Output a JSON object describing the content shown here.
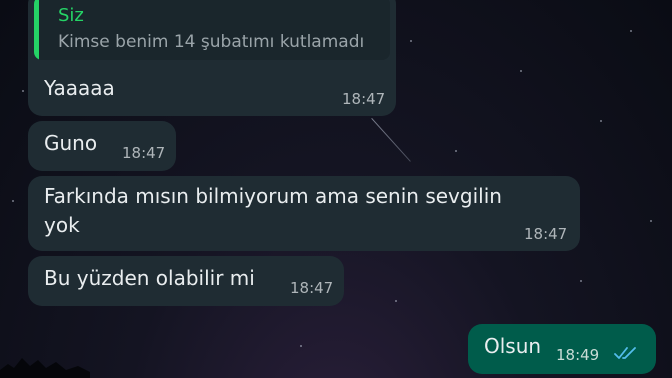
{
  "reply_quote": {
    "author": "Siz",
    "text": "Kimse benim 14 şubatımı kutlamadı"
  },
  "messages": [
    {
      "text": "Yaaaaa",
      "time": "18:47",
      "direction": "in"
    },
    {
      "text": "Guno",
      "time": "18:47",
      "direction": "in"
    },
    {
      "text_line1": "Farkında mısın bilmiyorum ama senin sevgilin",
      "text_line2": "yok",
      "time": "18:47",
      "direction": "in"
    },
    {
      "text": "Bu yüzden olabilir mi",
      "time": "18:47",
      "direction": "in"
    },
    {
      "text": "Olsun",
      "time": "18:49",
      "direction": "out",
      "status": "read"
    }
  ],
  "colors": {
    "incoming_bubble": "#1f2c33",
    "outgoing_bubble": "#005c4b",
    "quote_accent": "#25d366",
    "read_ticks": "#53bdeb"
  },
  "icons": {
    "read_receipt": "double-check-icon"
  }
}
